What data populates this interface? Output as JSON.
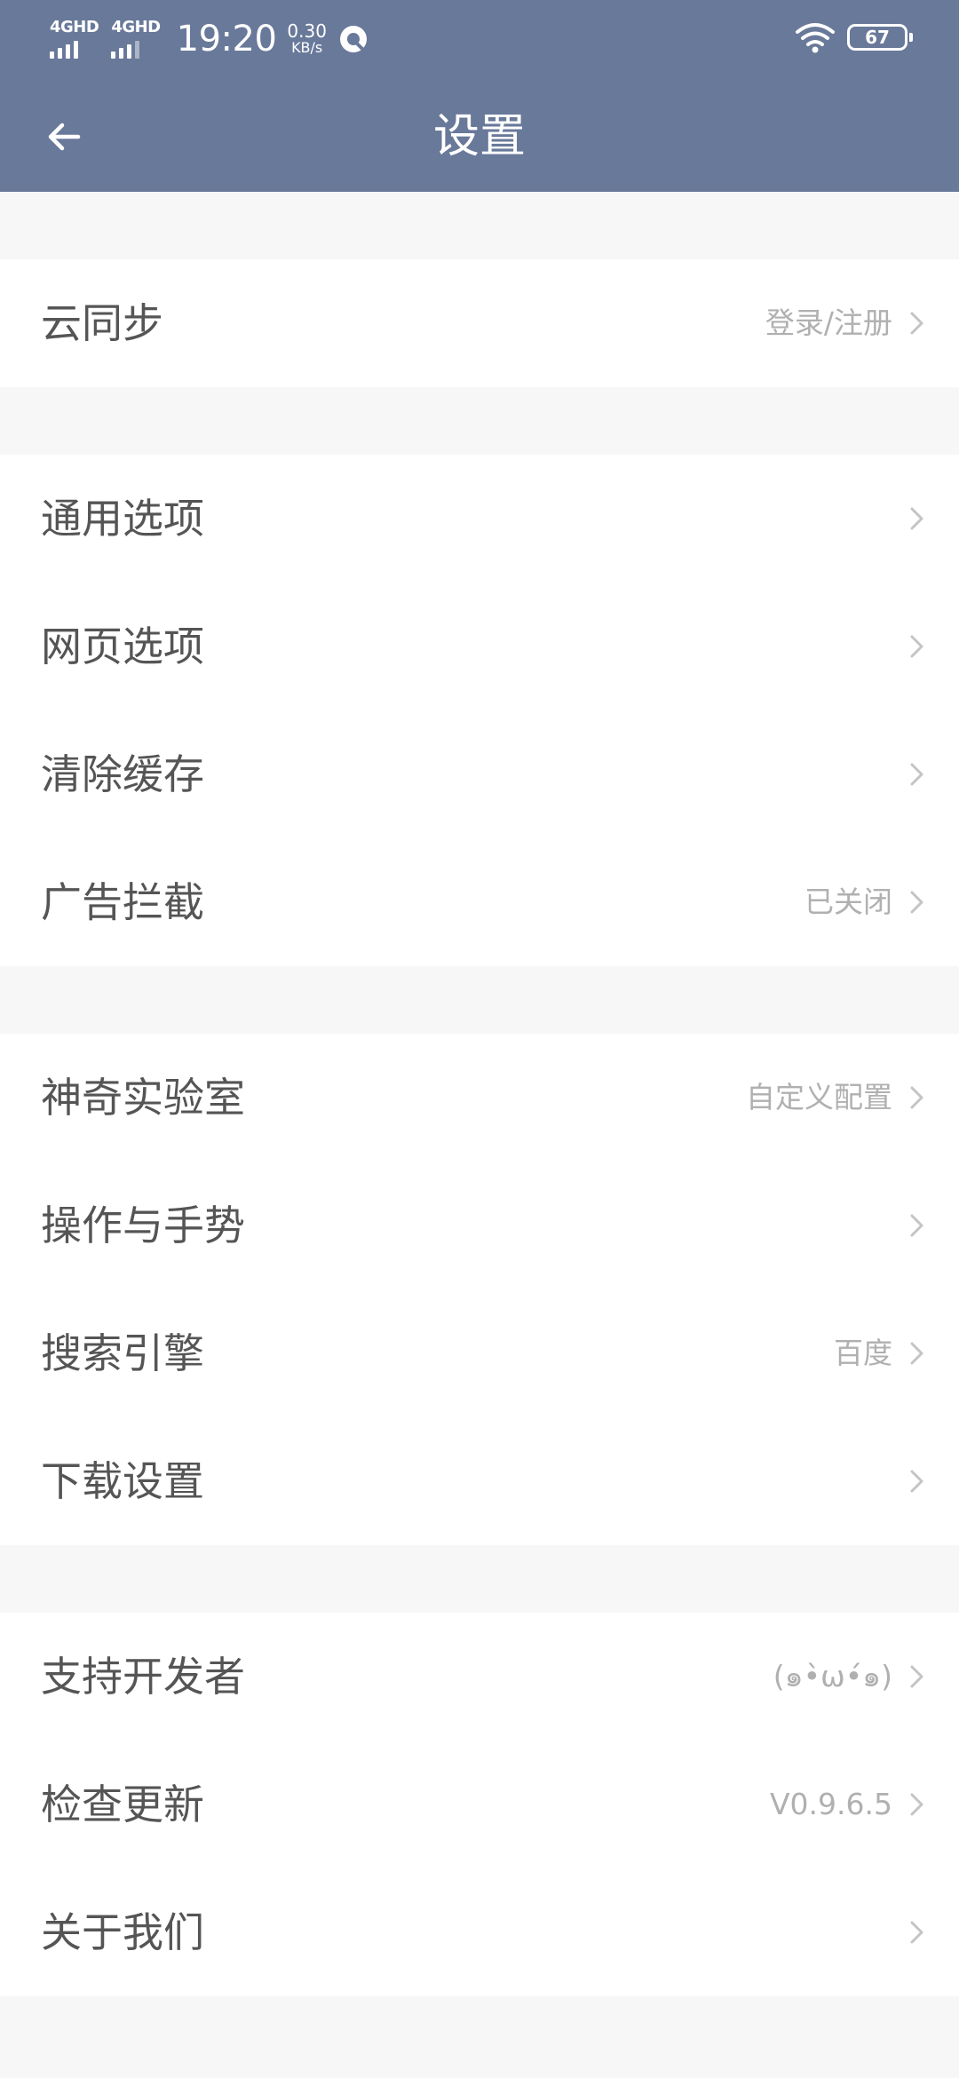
{
  "status_bar": {
    "signal_1": "4GHD",
    "signal_2": "4GHD",
    "time": "19:20",
    "net_speed_value": "0.30",
    "net_speed_unit": "KB/s",
    "battery": "67"
  },
  "app_bar": {
    "title": "设置"
  },
  "groups": [
    {
      "rows": [
        {
          "label": "云同步",
          "value": "登录/注册"
        }
      ]
    },
    {
      "rows": [
        {
          "label": "通用选项",
          "value": ""
        },
        {
          "label": "网页选项",
          "value": ""
        },
        {
          "label": "清除缓存",
          "value": ""
        },
        {
          "label": "广告拦截",
          "value": "已关闭"
        }
      ]
    },
    {
      "rows": [
        {
          "label": "神奇实验室",
          "value": "自定义配置"
        },
        {
          "label": "操作与手势",
          "value": ""
        },
        {
          "label": "搜索引擎",
          "value": "百度"
        },
        {
          "label": "下载设置",
          "value": ""
        }
      ]
    },
    {
      "rows": [
        {
          "label": "支持开发者",
          "value": "(๑•̀ω•́๑)"
        },
        {
          "label": "检查更新",
          "value": "V0.9.6.5"
        },
        {
          "label": "关于我们",
          "value": ""
        }
      ]
    }
  ],
  "colors": {
    "header_bg": "#69799a",
    "page_bg": "#f7f7f7",
    "label_text": "#555555",
    "value_text": "#b0b0b0"
  }
}
